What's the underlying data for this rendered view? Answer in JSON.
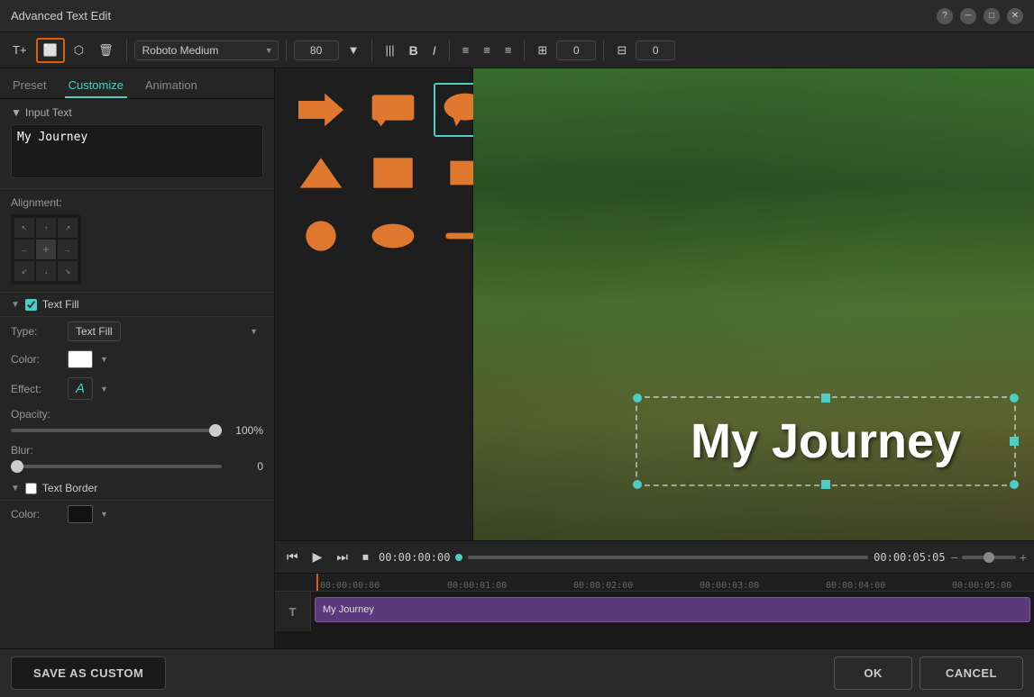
{
  "window": {
    "title": "Advanced Text Edit"
  },
  "tabs": {
    "items": [
      "Preset",
      "Customize",
      "Animation"
    ],
    "active": "Customize"
  },
  "toolbar": {
    "font": "Roboto Medium",
    "font_size": "80",
    "bold_icon": "B",
    "italic_icon": "I",
    "align_left": "≡",
    "align_center": "≡",
    "align_right": "≡",
    "spacing_icon": "|||",
    "spacing_value": "0",
    "offset_value": "0"
  },
  "input_text": {
    "section_label": "Input Text",
    "value": "My Journey"
  },
  "alignment": {
    "label": "Alignment:"
  },
  "text_fill": {
    "section_label": "Text Fill",
    "enabled": true,
    "type_label": "Type:",
    "type_value": "Text Fill",
    "color_label": "Color:",
    "effect_label": "Effect:",
    "opacity_label": "Opacity:",
    "opacity_value": "100%",
    "blur_label": "Blur:",
    "blur_value": "0"
  },
  "text_border": {
    "section_label": "Text Border",
    "enabled": false,
    "color_label": "Color:"
  },
  "preview": {
    "text": "My Journey"
  },
  "timeline": {
    "current_time": "00:00:00:00",
    "total_time": "00:00:05:05",
    "clip_label": "My Journey",
    "markers": [
      "00:00:00:00",
      "00:00:01:00",
      "00:00:02:00",
      "00:00:03:00",
      "00:00:04:00",
      "00:00:05:00"
    ]
  },
  "buttons": {
    "save_custom": "SAVE AS CUSTOM",
    "ok": "OK",
    "cancel": "CANCEL"
  },
  "shapes": [
    {
      "id": "arrow",
      "label": "arrow"
    },
    {
      "id": "speech-rect",
      "label": "speech bubble rect"
    },
    {
      "id": "speech-round",
      "label": "speech bubble round",
      "selected": true
    },
    {
      "id": "triangle",
      "label": "triangle"
    },
    {
      "id": "square",
      "label": "square"
    },
    {
      "id": "small-square",
      "label": "small square"
    },
    {
      "id": "circle",
      "label": "circle"
    },
    {
      "id": "ellipse",
      "label": "ellipse"
    },
    {
      "id": "line",
      "label": "line"
    }
  ]
}
